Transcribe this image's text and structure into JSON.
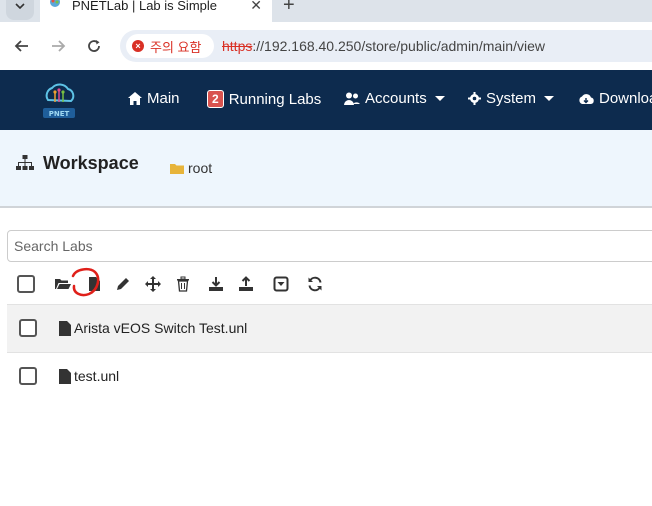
{
  "browser": {
    "tab_title": "PNETLab | Lab is Simple",
    "security_chip": "주의 요함",
    "url_scheme": "https",
    "url_rest": "://192.168.40.250/store/public/admin/main/view"
  },
  "navbar": {
    "main": "Main",
    "running_count": "2",
    "running": "Running Labs",
    "accounts": "Accounts",
    "system": "System",
    "download": "Download"
  },
  "workspace": {
    "title": "Workspace",
    "folder": "root"
  },
  "search": {
    "placeholder": "Search Labs"
  },
  "files": [
    {
      "name": "Arista vEOS Switch Test.unl"
    },
    {
      "name": "test.unl"
    }
  ],
  "colors": {
    "navbar": "#0d2b4e",
    "workspace_bg": "#eef6fd",
    "annotation": "#e0201a"
  }
}
